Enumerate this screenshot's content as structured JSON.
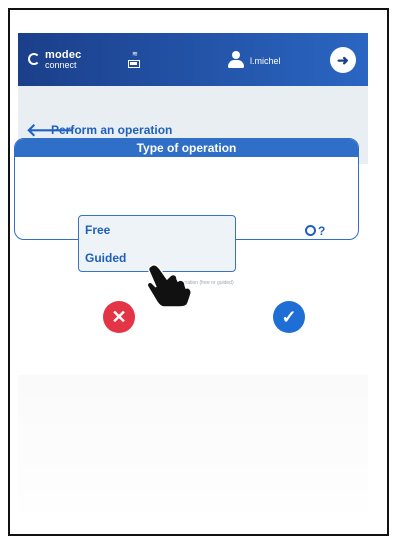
{
  "app": {
    "logo_line1": "modec",
    "logo_line2": "connect",
    "user_name": "l.michel"
  },
  "icons": {
    "battery": "battery-icon",
    "user": "user-icon",
    "logout": "logout-icon",
    "back": "arrow-left-icon",
    "help": "gear-help-icon",
    "cancel": "cancel-icon",
    "confirm": "check-icon",
    "cursor": "hand-cursor-icon"
  },
  "colors": {
    "primary": "#2f6fc7",
    "header_start": "#1b3f8a",
    "header_end": "#2a66c2",
    "cancel": "#e33546",
    "confirm": "#1e6ed6",
    "titlebar_bg": "#e9eef2"
  },
  "page": {
    "title": "Perform an operation"
  },
  "operation": {
    "section_title": "Type of operation",
    "options": [
      "Free",
      "Guided"
    ],
    "help_mark": "?",
    "hint": "Select ... operation (free or guided)"
  },
  "actions": {
    "cancel_glyph": "✕",
    "confirm_glyph": "✓"
  }
}
